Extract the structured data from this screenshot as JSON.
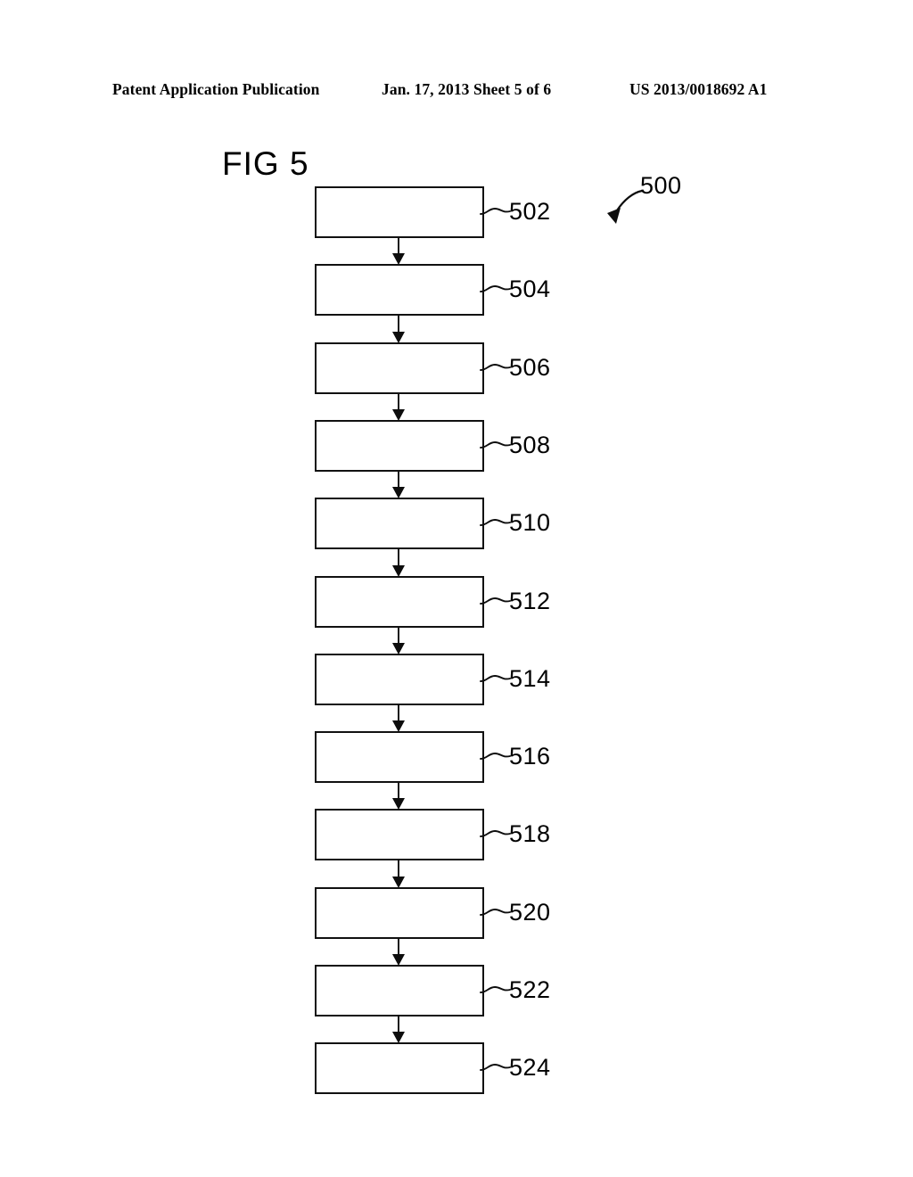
{
  "page": {
    "background_color": "#ffffff",
    "ink_color": "#000000"
  },
  "header": {
    "left": "Patent Application Publication",
    "middle": "Jan. 17, 2013  Sheet 5 of 6",
    "right": "US 2013/0018692 A1"
  },
  "figure": {
    "label": "FIG 5",
    "overall_reference": "500",
    "nodes": [
      {
        "ref": "502"
      },
      {
        "ref": "504"
      },
      {
        "ref": "506"
      },
      {
        "ref": "508"
      },
      {
        "ref": "510"
      },
      {
        "ref": "512"
      },
      {
        "ref": "514"
      },
      {
        "ref": "516"
      },
      {
        "ref": "518"
      },
      {
        "ref": "520"
      },
      {
        "ref": "522"
      },
      {
        "ref": "524"
      }
    ]
  }
}
